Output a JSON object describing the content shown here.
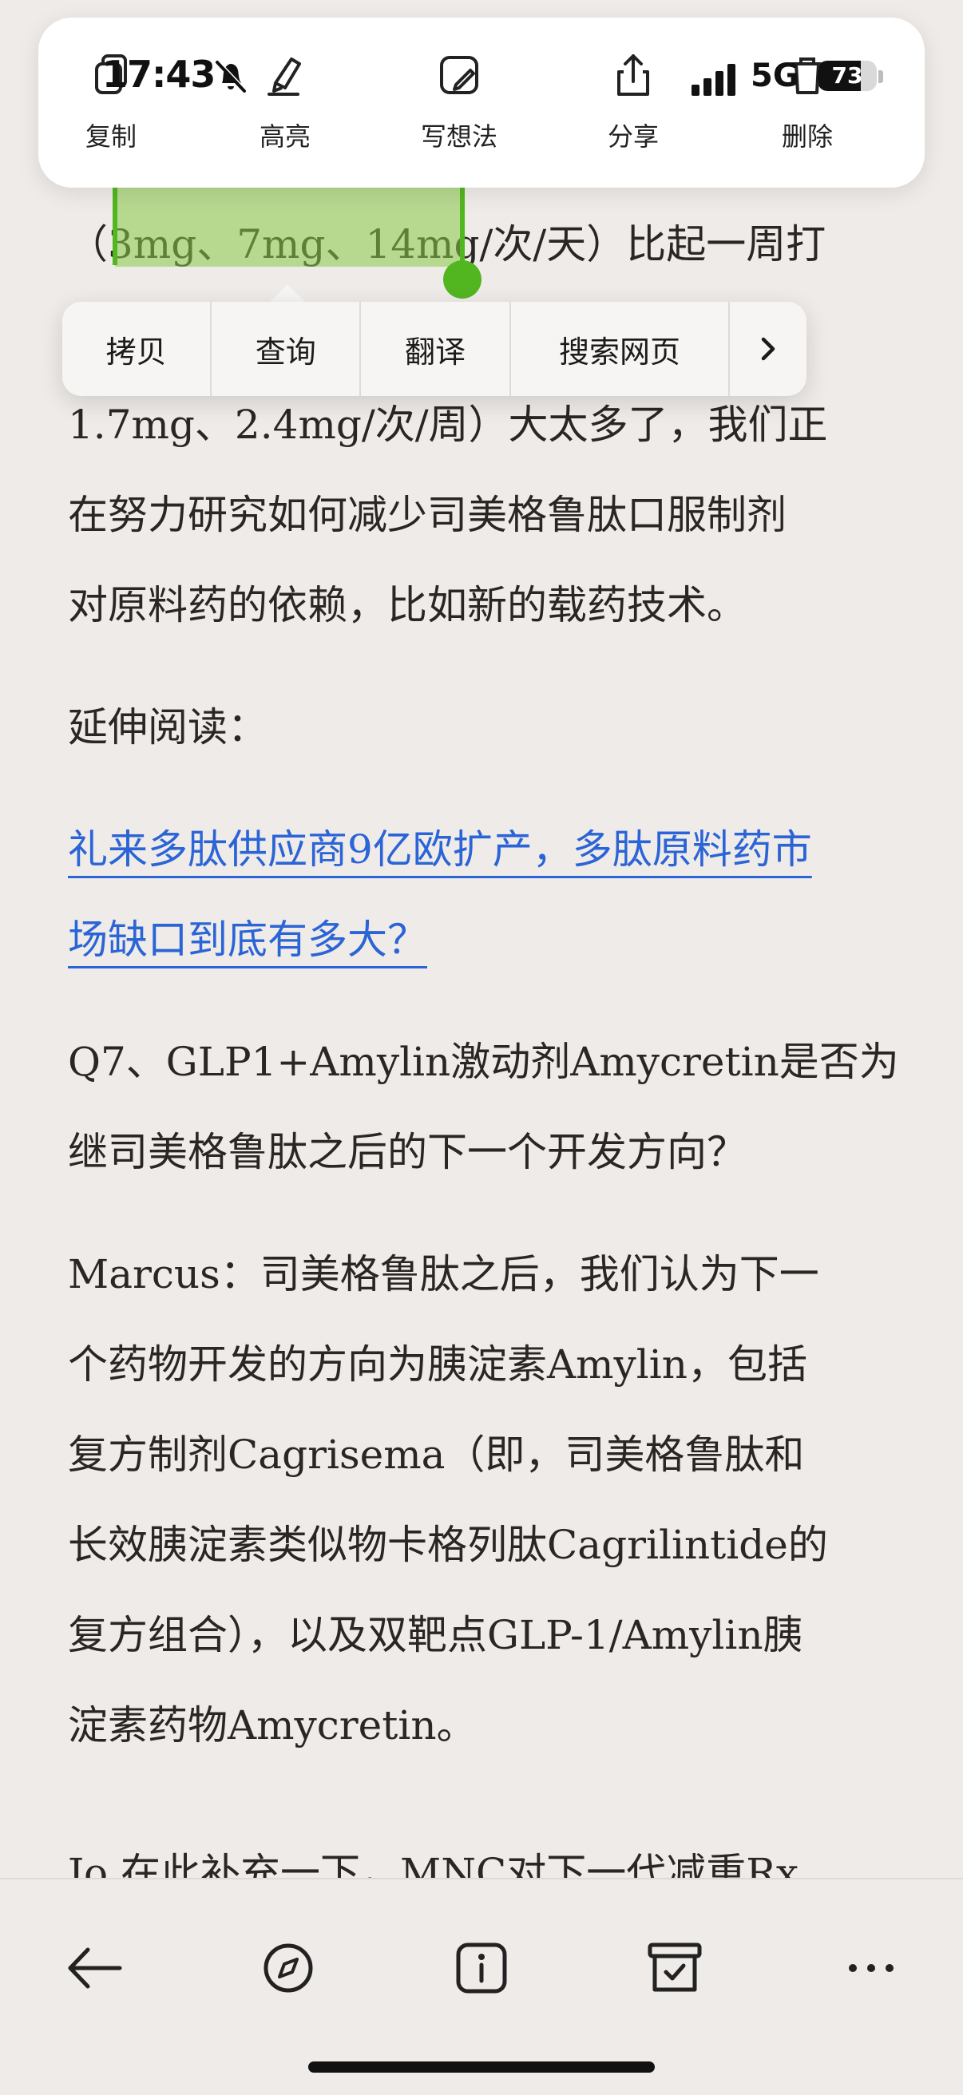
{
  "status_bar": {
    "time": "17:43",
    "network": "5G",
    "battery_level": "73",
    "battery_fraction": 0.73,
    "silent_icon": "bell-slash-icon",
    "signal_icon": "cellular-signal-icon"
  },
  "top_menu": {
    "items": [
      {
        "label": "复制",
        "icon": "copy-icon"
      },
      {
        "label": "高亮",
        "icon": "highlighter-icon"
      },
      {
        "label": "写想法",
        "icon": "note-pencil-icon"
      },
      {
        "label": "分享",
        "icon": "share-icon"
      },
      {
        "label": "删除",
        "icon": "trash-icon"
      }
    ]
  },
  "context_menu": {
    "items": [
      "拷贝",
      "查询",
      "翻译",
      "搜索网页"
    ],
    "more_icon": "chevron-right-icon"
  },
  "article": {
    "p1_lines": [
      "（3mg、7mg、14mg/次/天）比起一周打",
      "1.7mg、2.4mg/次/周）大太多了，我们正",
      "在努力研究如何减少司美格鲁肽口服制剂",
      "对原料药的依赖，比如新的载药技术。"
    ],
    "further_reading": "延伸阅读：",
    "link_lines": [
      "礼来多肽供应商9亿欧扩产，多肽原料药市",
      "场缺口到底有多大？"
    ],
    "q7_lines": [
      "Q7、GLP1+Amylin激动剂Amycretin是否为",
      "继司美格鲁肽之后的下一个开发方向？"
    ],
    "answer_lines": [
      "Marcus：司美格鲁肽之后，我们认为下一",
      "个药物开发的方向为胰淀素Amylin，包括",
      "复方制剂Cagrisema（即，司美格鲁肽和",
      "长效胰淀素类似物卡格列肽Cagrilintide的",
      "复方组合），以及双靶点GLP-1/Amylin胰",
      "淀素药物Amycretin。"
    ],
    "partial_line": "Jo 在此补充一下，MNC对下一代减重Rx"
  },
  "bottom_bar": {
    "icons": [
      "back-arrow-icon",
      "compass-icon",
      "info-icon",
      "archive-icon",
      "more-icon"
    ]
  },
  "colors": {
    "background": "#efebe8",
    "selection": "#87c846",
    "selection_handle": "#52b620",
    "link": "#2a64d6"
  }
}
